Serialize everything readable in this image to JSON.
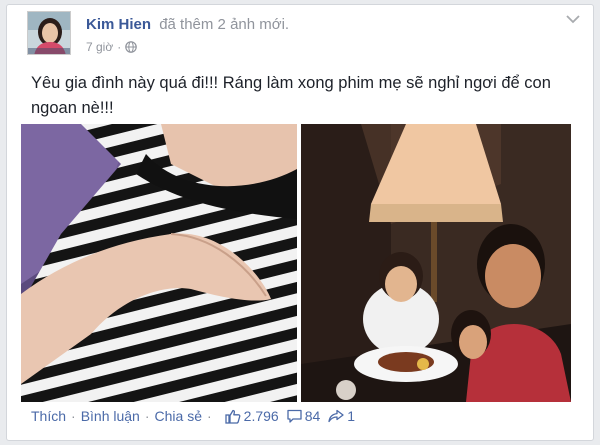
{
  "post": {
    "author": "Kim Hien",
    "action_text": "đã thêm 2 ảnh mới.",
    "time": "7 giờ",
    "audience_icon": "globe-icon",
    "text": "Yêu gia đình này quá đi!!! Ráng làm xong phim mẹ sẽ nghỉ ngơi để con ngoan nè!!!"
  },
  "actions": {
    "like": "Thích",
    "comment": "Bình luận",
    "share": "Chia sẻ"
  },
  "stats": {
    "likes": "2.796",
    "comments": "84",
    "shares": "1"
  },
  "colors": {
    "link": "#3b5998",
    "meta": "#90949c",
    "text": "#1d2129"
  }
}
